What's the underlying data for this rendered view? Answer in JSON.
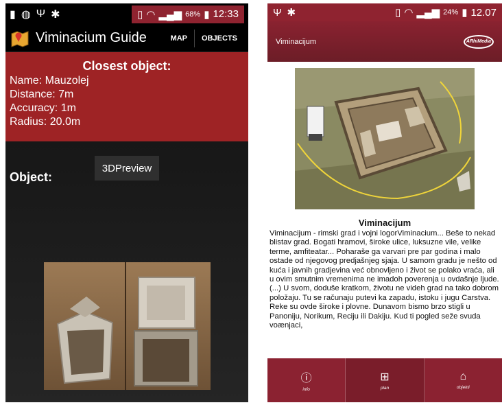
{
  "left": {
    "status": {
      "icons": [
        "battery-icon",
        "globe-icon",
        "usb-icon",
        "bug-icon"
      ],
      "battery_pct": "68%",
      "time": "12:33"
    },
    "appbar": {
      "title": "Viminacium Guide",
      "actions": [
        "MAP",
        "OBJECTS"
      ]
    },
    "closest": {
      "title": "Closest object:",
      "name": "Name: Mauzolej",
      "distance": "Distance: 7m",
      "accuracy": "Accuracy: 1m",
      "radius": "Radius: 20.0m"
    },
    "object_label": "Object:",
    "preview_button": "3DPreview"
  },
  "right": {
    "status": {
      "battery_pct": "24%",
      "time": "12.07"
    },
    "appbar": {
      "title": "Viminacijum",
      "logo": "ARhiMedia"
    },
    "site_title": "Viminacijum",
    "site_text": "Viminacijum - rimski grad i vojni logorViminacium... Beše to nekad blistav grad. Bogati hramovi, široke ulice, luksuzne vile, velike terme, amfiteatar... Poharaše ga varvari pre par godina i malo ostade od njegovog predjašnjeg sjaja. U samom gradu je nešto od kuća i javnih gradjevina već obnovljeno i život se polako vraća, ali u ovim smutnim vremenima ne imadoh poverenja u ovdašnje ljude.(...) U svom, doduše kratkom, životu ne videh grad na tako dobrom položaju. Tu se računaju putevi ka zapadu, istoku i jugu Carstva. Reke su ovde široke i plovne. Dunavom bismo brzo stigli u Panoniju, Norikum, Reciju ili Dakiju. Kud ti pogled seže svuda voænjaci,",
    "nav": [
      {
        "label": "info",
        "icon": "info-icon"
      },
      {
        "label": "plan",
        "icon": "plan-icon"
      },
      {
        "label": "objekti",
        "icon": "building-icon"
      }
    ]
  }
}
